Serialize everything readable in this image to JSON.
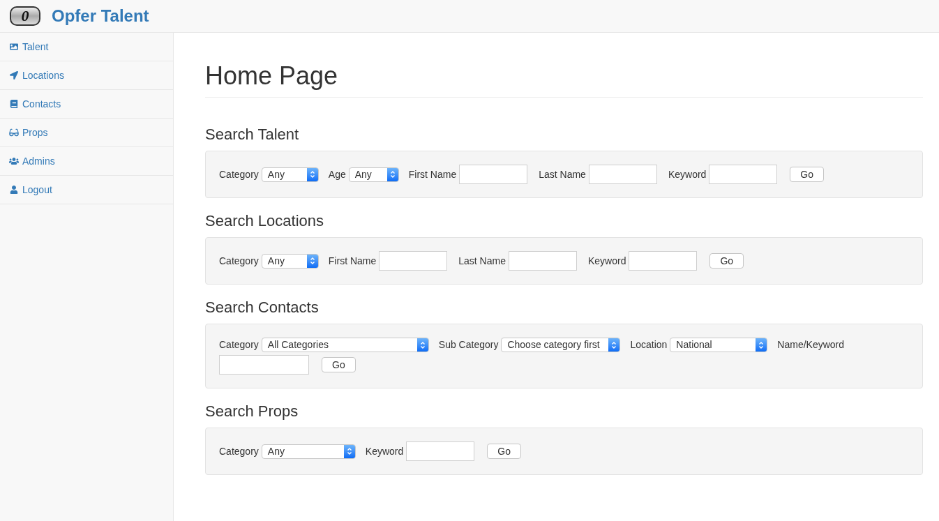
{
  "brand": {
    "name": "Opfer Talent",
    "logo_letter": "0"
  },
  "sidebar": {
    "items": [
      {
        "label": "Talent"
      },
      {
        "label": "Locations"
      },
      {
        "label": "Contacts"
      },
      {
        "label": "Props"
      },
      {
        "label": "Admins"
      },
      {
        "label": "Logout"
      }
    ]
  },
  "page_title": "Home Page",
  "sections": [
    {
      "title": "Search Talent",
      "fields": [
        {
          "kind": "select",
          "label": "Category",
          "value": "Any"
        },
        {
          "kind": "select",
          "label": "Age",
          "value": "Any"
        },
        {
          "kind": "input",
          "label": "First Name"
        },
        {
          "kind": "input",
          "label": "Last Name"
        },
        {
          "kind": "input",
          "label": "Keyword"
        },
        {
          "kind": "button",
          "label": "Go"
        }
      ]
    },
    {
      "title": "Search Locations",
      "fields": [
        {
          "kind": "select",
          "label": "Category",
          "value": "Any"
        },
        {
          "kind": "input",
          "label": "First Name"
        },
        {
          "kind": "input",
          "label": "Last Name"
        },
        {
          "kind": "input",
          "label": "Keyword"
        },
        {
          "kind": "button",
          "label": "Go"
        }
      ]
    },
    {
      "title": "Search Contacts",
      "fields": [
        {
          "kind": "select",
          "label": "Category",
          "value": "All Categories"
        },
        {
          "kind": "select",
          "label": "Sub Category",
          "value": "Choose category first"
        },
        {
          "kind": "select",
          "label": "Location",
          "value": "National"
        },
        {
          "kind": "input",
          "label": "Name/Keyword"
        },
        {
          "kind": "button",
          "label": "Go"
        }
      ]
    },
    {
      "title": "Search Props",
      "fields": [
        {
          "kind": "select",
          "label": "Category",
          "value": "Any"
        },
        {
          "kind": "input",
          "label": "Keyword"
        },
        {
          "kind": "button",
          "label": "Go"
        }
      ]
    }
  ]
}
